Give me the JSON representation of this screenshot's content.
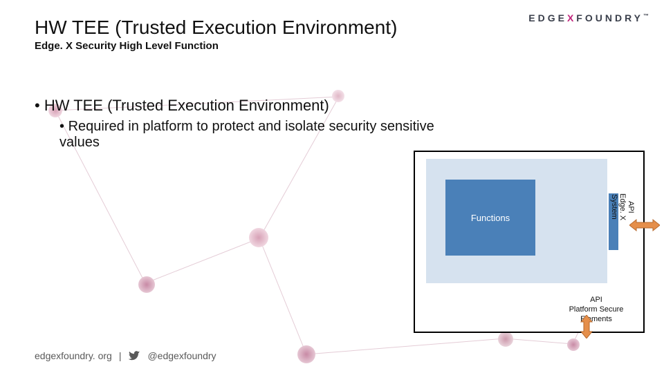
{
  "header": {
    "title": "HW TEE (Trusted Execution Environment)",
    "subtitle": "Edge. X Security High Level Function"
  },
  "logo": {
    "part1": "EDGE",
    "part2": "X",
    "part3": "FOUNDRY",
    "tm": "™"
  },
  "bullets": {
    "l1": "HW TEE (Trusted Execution Environment)",
    "l2": "Required in platform to protect and isolate security sensitive values"
  },
  "diagram": {
    "functions": "Functions",
    "api_bottom": "API\nPlatform Secure\nElements",
    "api_side": "API\nEdge. X\nSystem"
  },
  "footer": {
    "url": "edgexfoundry. org",
    "sep": "|",
    "handle": "@edgexfoundry"
  },
  "colors": {
    "accent": "#c0247b",
    "box": "#4a80b8",
    "panel": "#d6e2ef"
  }
}
